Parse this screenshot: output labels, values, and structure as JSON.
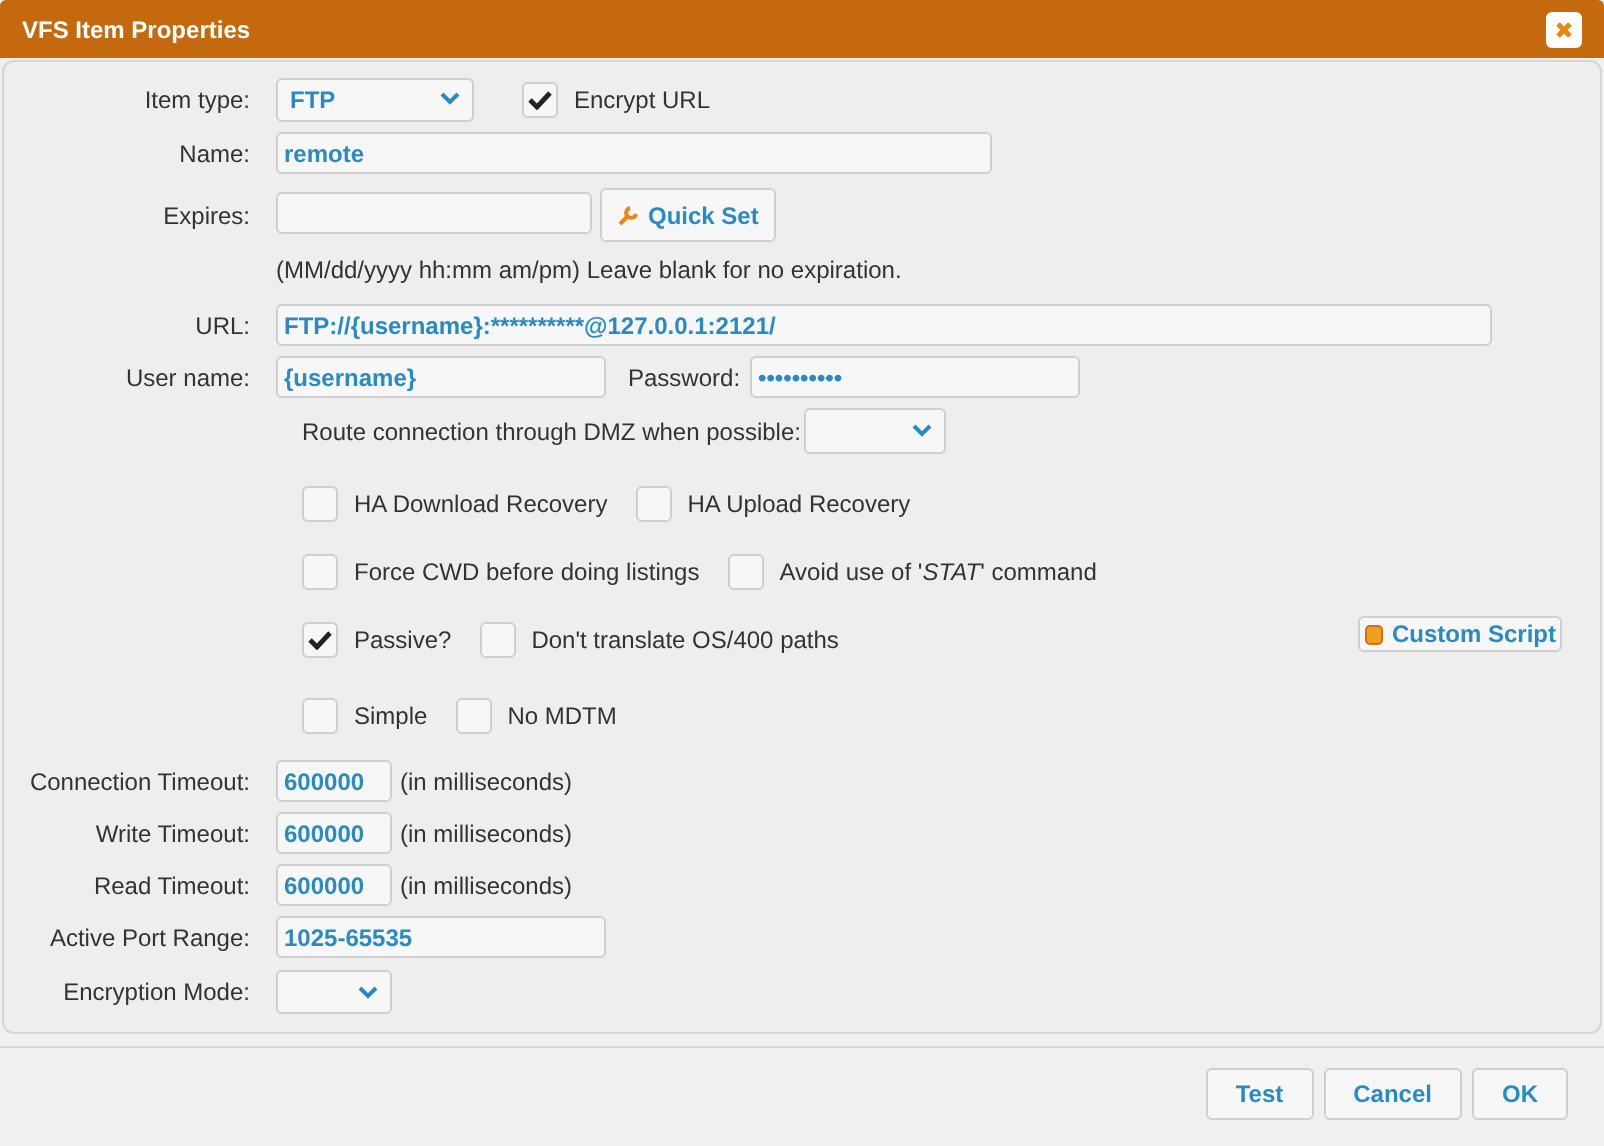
{
  "window": {
    "title": "VFS Item Properties"
  },
  "item_type": {
    "label": "Item type:",
    "value": "FTP"
  },
  "encrypt_url": {
    "label": "Encrypt URL",
    "checked": true
  },
  "name": {
    "label": "Name:",
    "value": "remote"
  },
  "expires": {
    "label": "Expires:",
    "button": "Quick Set",
    "hint": "(MM/dd/yyyy hh:mm am/pm) Leave blank for no expiration."
  },
  "url": {
    "label": "URL:",
    "value": "FTP://{username}:**********@127.0.0.1:2121/"
  },
  "user_name": {
    "label": "User name:",
    "value": "{username}"
  },
  "password": {
    "label": "Password:",
    "value": "••••••••••"
  },
  "dmz": {
    "label": "Route connection through DMZ when possible:"
  },
  "option_rows": [
    [
      {
        "label": "HA Download Recovery",
        "checked": false
      },
      {
        "label": "HA Upload Recovery",
        "checked": false
      }
    ],
    [
      {
        "label": "Force CWD before doing listings",
        "checked": false
      },
      {
        "label": "Avoid use of '*STAT*' command",
        "checked": false
      }
    ],
    [
      {
        "label": "Passive?",
        "checked": true
      },
      {
        "label": "Don't translate OS/400 paths",
        "checked": false
      }
    ],
    [
      {
        "label": "Simple",
        "checked": false
      },
      {
        "label": "No MDTM",
        "checked": false
      }
    ]
  ],
  "custom_script": "Custom Script",
  "timeouts": [
    {
      "label": "Connection Timeout:",
      "value": "600000",
      "unit": "(in milliseconds)"
    },
    {
      "label": "Write Timeout:",
      "value": "600000",
      "unit": "(in milliseconds)"
    },
    {
      "label": "Read Timeout:",
      "value": "600000",
      "unit": "(in milliseconds)"
    }
  ],
  "port_range": {
    "label": "Active Port Range:",
    "value": "1025-65535"
  },
  "encryption_mode": {
    "label": "Encryption Mode:"
  },
  "buttons": [
    "Test",
    "Cancel",
    "OK"
  ]
}
